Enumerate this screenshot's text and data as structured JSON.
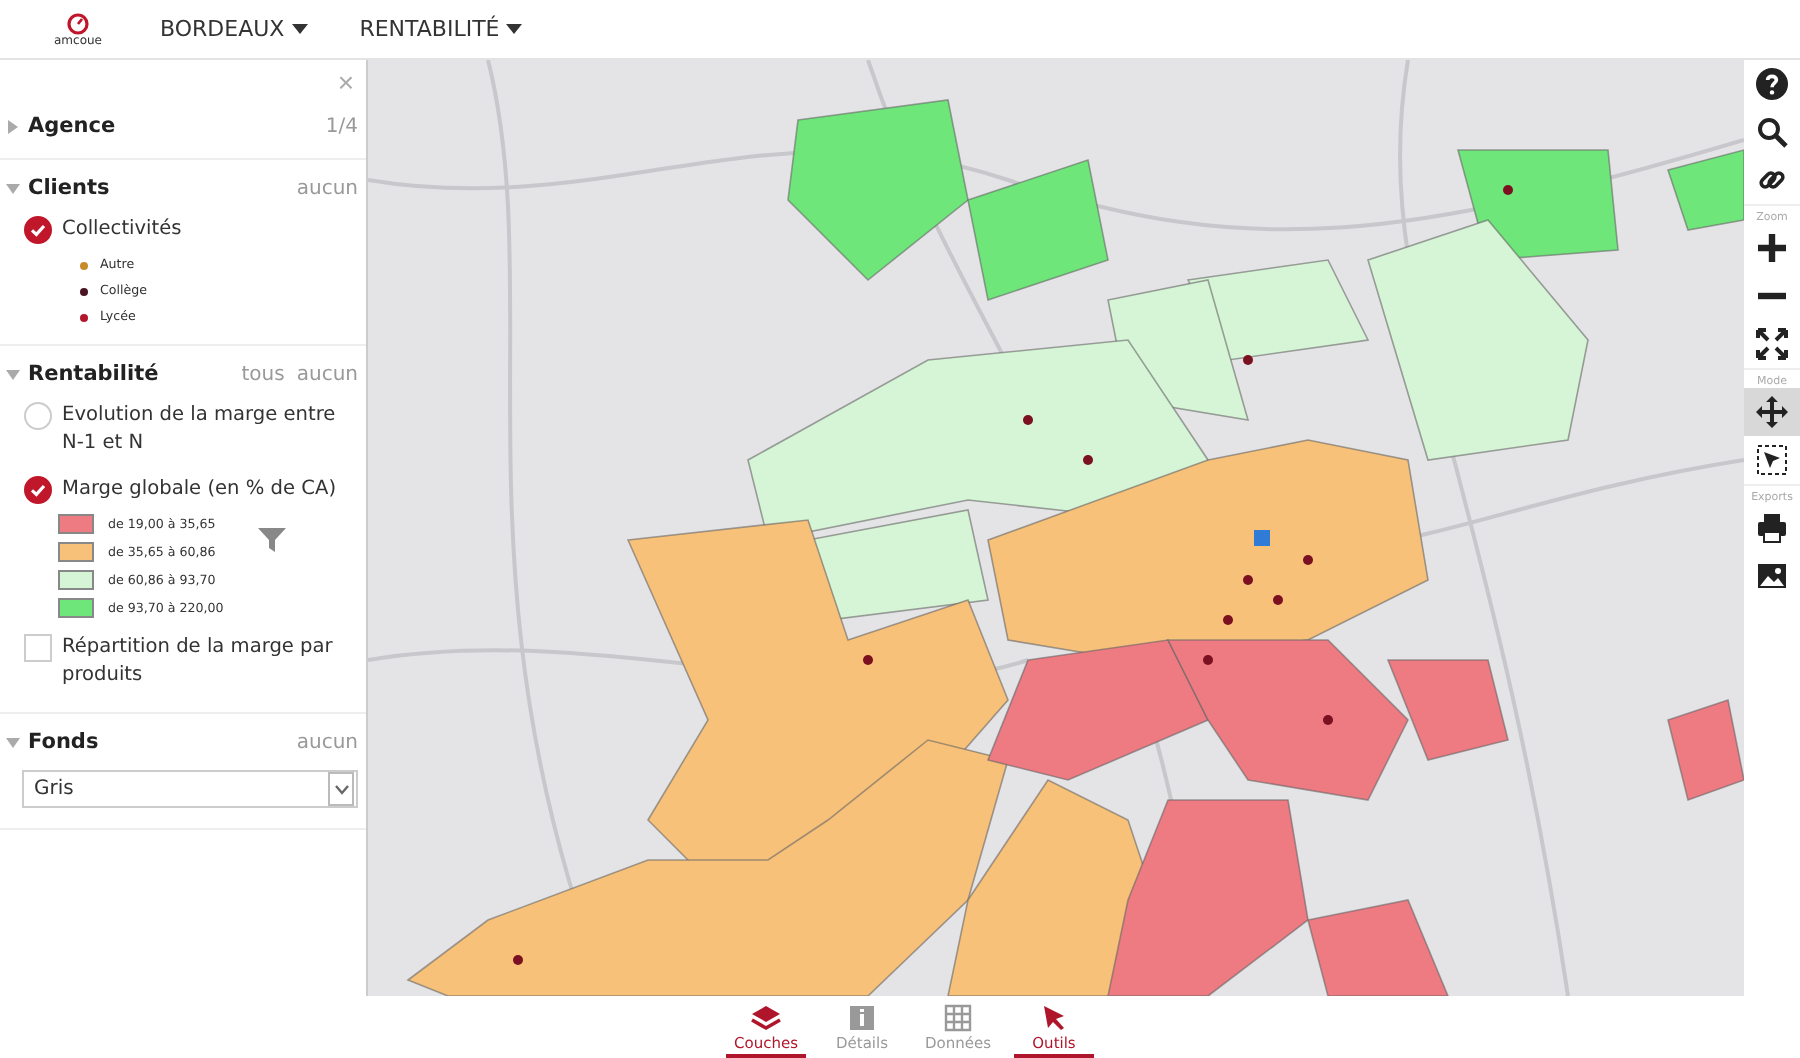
{
  "header": {
    "logo_text": "amcoue",
    "menus": [
      {
        "label": "BORDEAUX"
      },
      {
        "label": "RENTABILITÉ"
      }
    ]
  },
  "panel": {
    "close": "×",
    "sections": [
      {
        "title": "Agence",
        "expanded": false,
        "actions": [
          "1/4"
        ]
      },
      {
        "title": "Clients",
        "expanded": true,
        "actions": [
          "aucun"
        ],
        "options": [
          {
            "kind": "radio",
            "label": "Collectivités",
            "checked": true,
            "legend": [
              {
                "label": "Autre",
                "color": "#c98a2c"
              },
              {
                "label": "Collège",
                "color": "#4a1424"
              },
              {
                "label": "Lycée",
                "color": "#b3172b"
              }
            ]
          }
        ]
      },
      {
        "title": "Rentabilité",
        "expanded": true,
        "actions": [
          "tous",
          "aucun"
        ],
        "options": [
          {
            "kind": "radio",
            "label": "Evolution de la marge entre N-1 et N",
            "checked": false
          },
          {
            "kind": "radio",
            "label": "Marge globale (en % de CA)",
            "checked": true,
            "classes": [
              {
                "label": "de 19,00 à 35,65",
                "color": "#ee7a82"
              },
              {
                "label": "de 35,65 à 60,86",
                "color": "#f7c17a"
              },
              {
                "label": "de 60,86 à 93,70",
                "color": "#d6f5d6"
              },
              {
                "label": "de 93,70 à 220,00",
                "color": "#6ee67a"
              }
            ]
          },
          {
            "kind": "checkbox",
            "label": "Répartition de la marge par produits",
            "checked": false
          }
        ]
      },
      {
        "title": "Fonds",
        "expanded": true,
        "actions": [
          "aucun"
        ],
        "select": {
          "value": "Gris"
        }
      }
    ]
  },
  "toolbar": [
    {
      "kind": "help"
    },
    {
      "kind": "search"
    },
    {
      "kind": "link"
    },
    {
      "kind": "heading",
      "label": "Zoom"
    },
    {
      "kind": "zoom-in"
    },
    {
      "kind": "zoom-out"
    },
    {
      "kind": "fullscreen"
    },
    {
      "kind": "heading",
      "label": "Mode"
    },
    {
      "kind": "move",
      "selected": true
    },
    {
      "kind": "select",
      "selected": false
    },
    {
      "kind": "heading",
      "label": "Exports"
    },
    {
      "kind": "print"
    },
    {
      "kind": "image"
    }
  ],
  "bottom_tabs": [
    {
      "label": "Couches",
      "kind": "layers",
      "selected": true
    },
    {
      "label": "Détails",
      "kind": "details",
      "selected": false
    },
    {
      "label": "Données",
      "kind": "grid",
      "selected": false
    },
    {
      "label": "Outils",
      "kind": "cursor",
      "selected": true
    }
  ]
}
